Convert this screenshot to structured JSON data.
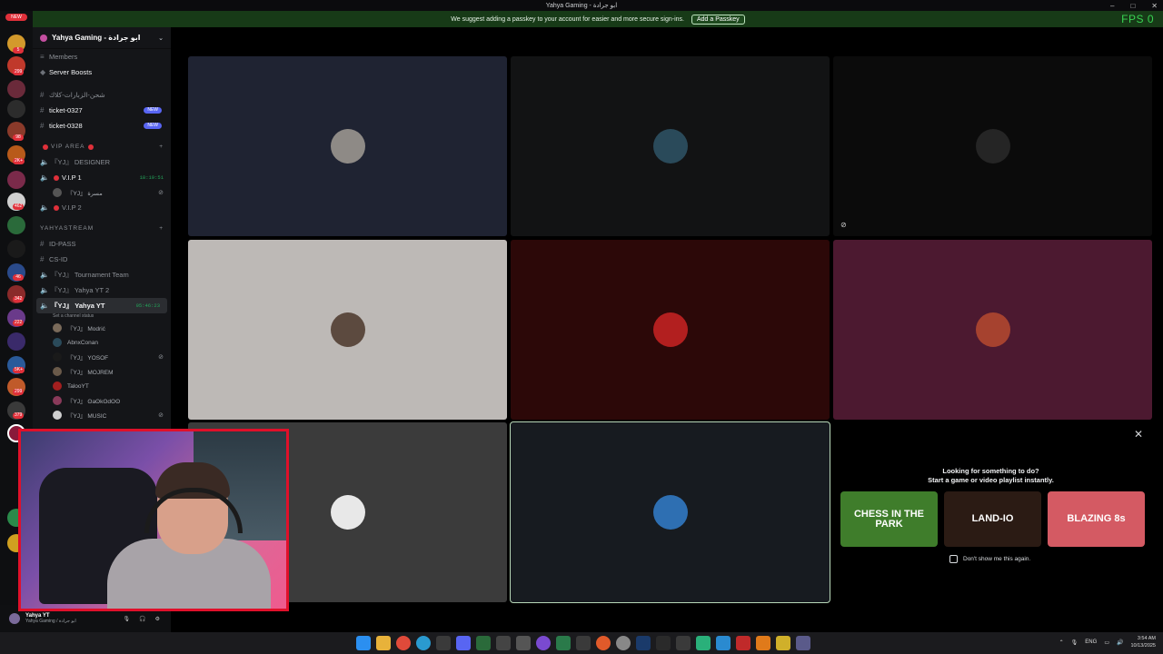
{
  "window": {
    "title": "Yahya Gaming - ابو جرادة"
  },
  "notice": {
    "text": "We suggest adding a passkey to your account for easier and more secure sign-ins.",
    "button": "Add a Passkey",
    "fps": "FPS  0"
  },
  "rail": {
    "new_badge": "NEW",
    "badges": [
      "64",
      "5",
      "299",
      "21",
      "98",
      "2K+",
      "3K+",
      "462",
      "46",
      "342",
      "222",
      "28",
      "5K+",
      "299",
      "379",
      "36"
    ]
  },
  "sidebar": {
    "server_name": "Yahya Gaming - ابو جرادة",
    "members": "Members",
    "boosts": "Server Boosts",
    "channels": {
      "arabic_channel": "شحن-الزبارات-كلاك",
      "ticket1": "ticket-0327",
      "ticket2": "ticket-0328",
      "new_pill": "NEW",
      "cat_vip": "VIP AREA",
      "designer": "『YJ』 DESIGNER",
      "vip1": "V.I.P 1",
      "vip1_time": "18:19:51",
      "vip1_user": "『YJ』 مسرة",
      "vip2": "V.I.P 2",
      "cat_yahya": "YAHYASTREAM",
      "idpass": "ID-PASS",
      "csid": "CS-ID",
      "tourn": "『YJ』 Tournament Team",
      "yahya2": "『YJ』 Yahya YT 2",
      "yahya": "『YJ』 Yahya YT",
      "yahya_time": "95:46:23",
      "status": "Set a channel status"
    },
    "voice_users": [
      "『YJ』 Modrić",
      "AbnxConan",
      "『YJ』 YOSOF",
      "『YJ』 MOJREM",
      "TalooYT",
      "『YJ』 ʘaʘkʘdʘʘ",
      "『YJ』 MUSIC"
    ]
  },
  "user_panel": {
    "name": "Yahya YT",
    "sub": "Yahya Gaming / ابو جرادة"
  },
  "tiles": [
    {
      "name": "tile-1",
      "bg": "#1f2332",
      "avatar": "#8e8a86"
    },
    {
      "name": "tile-2",
      "bg": "#121314",
      "avatar": "#2a4a5a"
    },
    {
      "name": "tile-3",
      "bg": "#0b0b0b",
      "avatar": "#252525"
    },
    {
      "name": "tile-4",
      "bg": "#bdb9b6",
      "avatar": "#5c4a3f"
    },
    {
      "name": "tile-5",
      "bg": "#2c0808",
      "avatar": "#b21f1f"
    },
    {
      "name": "tile-6",
      "bg": "#4c1930",
      "avatar": "#a6422f"
    },
    {
      "name": "tile-7",
      "bg": "#3b3b3b",
      "avatar": "#e8e8e8"
    },
    {
      "name": "tile-8",
      "bg": "#171b20",
      "avatar": "#2e6fb2"
    }
  ],
  "activities": {
    "title": "Looking for something to do?",
    "subtitle": "Start a game or video playlist instantly.",
    "items": [
      {
        "label": "CHESS IN THE PARK",
        "color": "#3f7d2b"
      },
      {
        "label": "LAND-IO",
        "color": "#2b1b14"
      },
      {
        "label": "BLAZING 8s",
        "color": "#d45a63"
      }
    ],
    "dont_show": "Don't show me this again."
  },
  "taskbar": {
    "lang": "ENG",
    "time": "3:54 AM",
    "date": "10/13/2025"
  }
}
